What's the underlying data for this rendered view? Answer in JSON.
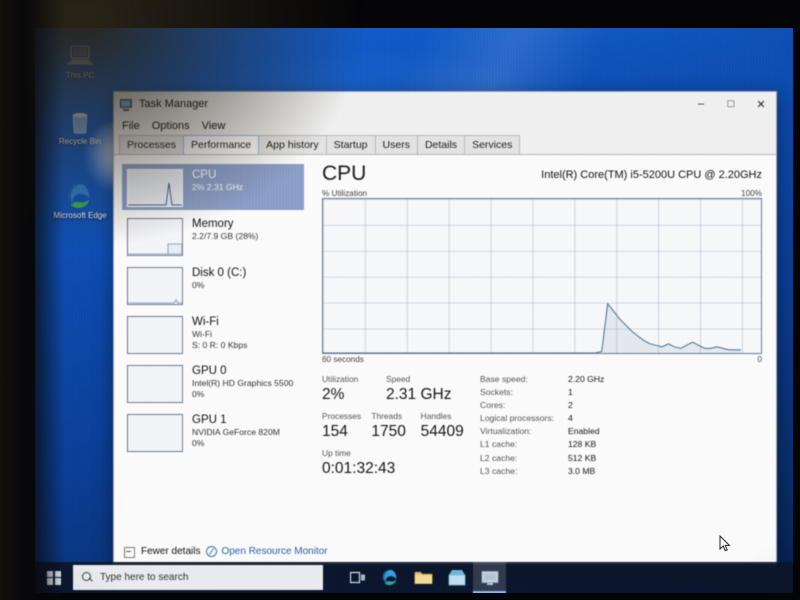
{
  "desktop": {
    "icons": [
      {
        "name": "this-pc",
        "label": "This PC"
      },
      {
        "name": "recycle-bin",
        "label": "Recycle Bin"
      },
      {
        "name": "microsoft-edge",
        "label": "Microsoft Edge"
      }
    ]
  },
  "window": {
    "title": "Task Manager",
    "icon": "task-manager-icon",
    "controls": {
      "minimize": "–",
      "maximize": "□",
      "close": "✕"
    },
    "menu": [
      "File",
      "Options",
      "View"
    ],
    "tabs": [
      {
        "label": "Processes",
        "active": false
      },
      {
        "label": "Performance",
        "active": true
      },
      {
        "label": "App history",
        "active": false
      },
      {
        "label": "Startup",
        "active": false
      },
      {
        "label": "Users",
        "active": false
      },
      {
        "label": "Details",
        "active": false
      },
      {
        "label": "Services",
        "active": false
      }
    ]
  },
  "sidebar": {
    "items": [
      {
        "name": "cpu",
        "title": "CPU",
        "sub1": "2%  2.31 GHz",
        "sub2": "",
        "selected": true
      },
      {
        "name": "memory",
        "title": "Memory",
        "sub1": "2.2/7.9 GB (28%)",
        "sub2": "",
        "selected": false
      },
      {
        "name": "disk-0",
        "title": "Disk 0 (C:)",
        "sub1": "0%",
        "sub2": "",
        "selected": false
      },
      {
        "name": "wifi",
        "title": "Wi-Fi",
        "sub1": "Wi-Fi",
        "sub2": "S: 0 R: 0 Kbps",
        "selected": false
      },
      {
        "name": "gpu-0",
        "title": "GPU 0",
        "sub1": "Intel(R) HD Graphics 5500",
        "sub2": "0%",
        "selected": false
      },
      {
        "name": "gpu-1",
        "title": "GPU 1",
        "sub1": "NVIDIA GeForce 820M",
        "sub2": "0%",
        "selected": false
      }
    ]
  },
  "panel": {
    "heading": "CPU",
    "model": "Intel(R) Core(TM) i5-5200U CPU @ 2.20GHz",
    "graph_axis_label": "% Utilization",
    "graph_max_label": "100%",
    "graph_time_left": "60 seconds",
    "graph_time_right": "0",
    "stats": [
      {
        "label": "Utilization",
        "value": "2%"
      },
      {
        "label": "Speed",
        "value": "2.31 GHz"
      },
      {
        "label": "Processes",
        "value": "154"
      },
      {
        "label": "Threads",
        "value": "1750"
      },
      {
        "label": "Handles",
        "value": "54409"
      },
      {
        "label": "Up time",
        "value": "0:01:32:43"
      }
    ],
    "specs": [
      {
        "key": "Base speed:",
        "value": "2.20 GHz"
      },
      {
        "key": "Sockets:",
        "value": "1"
      },
      {
        "key": "Cores:",
        "value": "2"
      },
      {
        "key": "Logical processors:",
        "value": "4"
      },
      {
        "key": "Virtualization:",
        "value": "Enabled"
      },
      {
        "key": "L1 cache:",
        "value": "128 KB"
      },
      {
        "key": "L2 cache:",
        "value": "512 KB"
      },
      {
        "key": "L3 cache:",
        "value": "3.0 MB"
      }
    ]
  },
  "footer": {
    "fewer_details": "Fewer details",
    "open_resource_monitor": "Open Resource Monitor"
  },
  "taskbar": {
    "start": "start-button",
    "search_placeholder": "Type here to search",
    "icons": [
      {
        "name": "task-view",
        "active": false
      },
      {
        "name": "microsoft-edge",
        "active": false
      },
      {
        "name": "file-explorer",
        "active": false
      },
      {
        "name": "microsoft-store",
        "active": false
      },
      {
        "name": "task-manager",
        "active": true
      }
    ]
  },
  "chart_data": {
    "type": "area",
    "title": "% Utilization",
    "xlabel": "60 seconds",
    "ylabel": "% Utilization",
    "ylim": [
      0,
      100
    ],
    "xlim": [
      60,
      0
    ],
    "grid": true,
    "accent_color": "#4a6a95",
    "series": [
      {
        "name": "CPU utilization",
        "values": [
          0,
          0,
          0,
          0,
          0,
          0,
          0,
          0,
          0,
          0,
          0,
          0,
          0,
          0,
          0,
          0,
          0,
          0,
          0,
          0,
          0,
          0,
          0,
          0,
          0,
          0,
          0,
          0,
          0,
          0,
          0,
          0,
          0,
          0,
          0,
          0,
          0,
          0,
          0,
          0,
          0,
          0,
          0,
          0,
          0,
          0,
          1,
          32,
          27,
          22,
          18,
          14,
          11,
          8,
          6,
          5,
          4,
          6,
          4,
          3,
          5,
          7,
          5,
          3,
          3,
          4,
          3,
          2,
          2,
          2
        ]
      }
    ]
  }
}
